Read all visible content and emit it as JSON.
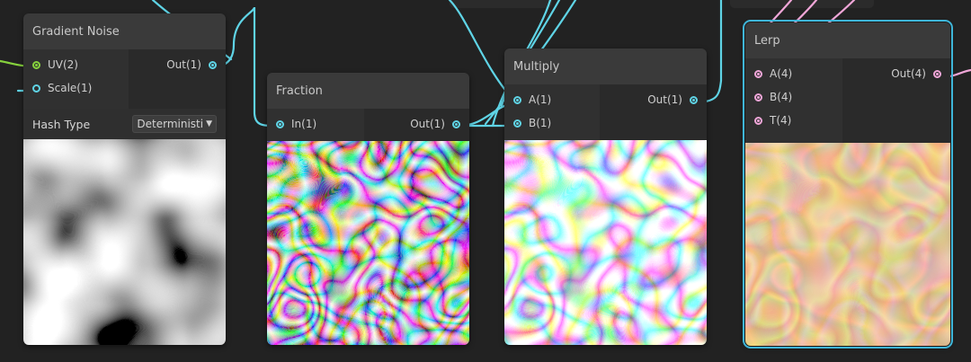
{
  "nodes": {
    "gradient_noise": {
      "title": "Gradient Noise",
      "inputs": [
        "UV(2)",
        "Scale(1)"
      ],
      "outputs": [
        "Out(1)"
      ],
      "hash_type_label": "Hash Type",
      "hash_type_value": "Deterministi"
    },
    "fraction": {
      "title": "Fraction",
      "inputs": [
        "In(1)"
      ],
      "outputs": [
        "Out(1)"
      ]
    },
    "multiply": {
      "title": "Multiply",
      "inputs": [
        "A(1)",
        "B(1)"
      ],
      "outputs": [
        "Out(1)"
      ]
    },
    "lerp": {
      "title": "Lerp",
      "inputs": [
        "A(4)",
        "B(4)",
        "T(4)"
      ],
      "outputs": [
        "Out(4)"
      ],
      "selected": true
    }
  },
  "colors": {
    "background": "#222222",
    "node_body": "#2b2b2b",
    "node_header": "#3a3a3a",
    "wire_float": "#5fd4e6",
    "wire_vector2": "#86d23d",
    "wire_vector4": "#f0a6d8",
    "selection_outline": "#3fb6d9",
    "wood_light": "#e6ad6c",
    "wood_dark": "#9a6530"
  },
  "icons": {
    "port_connector": "circle-port-icon",
    "dropdown": "triangle-down-icon"
  }
}
